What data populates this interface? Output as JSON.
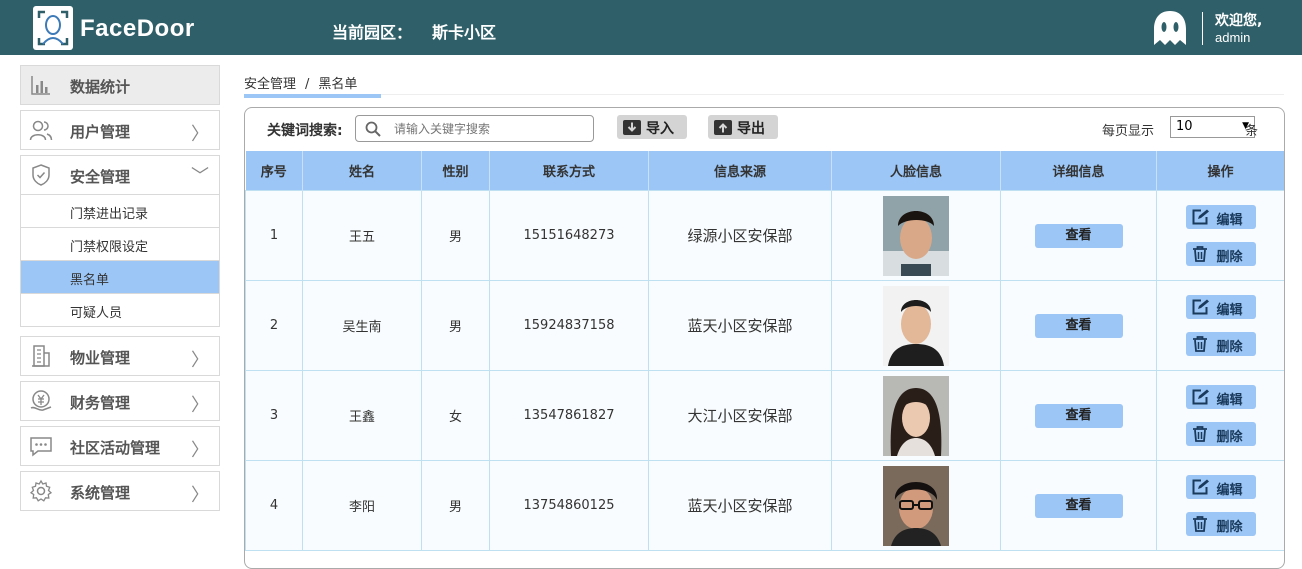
{
  "header": {
    "brand": "FaceDoor",
    "park_label": "当前园区：",
    "park_name": "斯卡小区",
    "welcome": "欢迎您,",
    "user": "admin"
  },
  "sidebar": {
    "items": [
      {
        "label": "数据统计",
        "icon": "bar-chart-icon"
      },
      {
        "label": "用户管理",
        "icon": "users-icon"
      },
      {
        "label": "安全管理",
        "icon": "shield-icon"
      },
      {
        "label": "物业管理",
        "icon": "building-icon"
      },
      {
        "label": "财务管理",
        "icon": "finance-icon"
      },
      {
        "label": "社区活动管理",
        "icon": "chat-icon"
      },
      {
        "label": "系统管理",
        "icon": "gear-icon"
      }
    ],
    "sub_items": [
      {
        "label": "门禁进出记录"
      },
      {
        "label": "门禁权限设定"
      },
      {
        "label": "黑名单"
      },
      {
        "label": "可疑人员"
      }
    ]
  },
  "breadcrumb": {
    "parent": "安全管理",
    "sep": "/",
    "current": "黑名单"
  },
  "toolbar": {
    "keyword_label": "关键词搜索:",
    "search_placeholder": "请输入关键字搜索",
    "import_label": "导入",
    "export_label": "导出",
    "per_page_label": "每页显示",
    "per_page_value": "10",
    "unit": "条"
  },
  "table": {
    "headers": [
      "序号",
      "姓名",
      "性别",
      "联系方式",
      "信息来源",
      "人脸信息",
      "详细信息",
      "操作"
    ],
    "view_label": "查看",
    "edit_label": "编辑",
    "delete_label": "删除",
    "rows": [
      {
        "no": "1",
        "name": "王五",
        "gender": "男",
        "phone": "15151648273",
        "source": "绿源小区安保部"
      },
      {
        "no": "2",
        "name": "吴生南",
        "gender": "男",
        "phone": "15924837158",
        "source": "蓝天小区安保部"
      },
      {
        "no": "3",
        "name": "王鑫",
        "gender": "女",
        "phone": "13547861827",
        "source": "大江小区安保部"
      },
      {
        "no": "4",
        "name": "李阳",
        "gender": "男",
        "phone": "13754860125",
        "source": "蓝天小区安保部"
      }
    ]
  }
}
